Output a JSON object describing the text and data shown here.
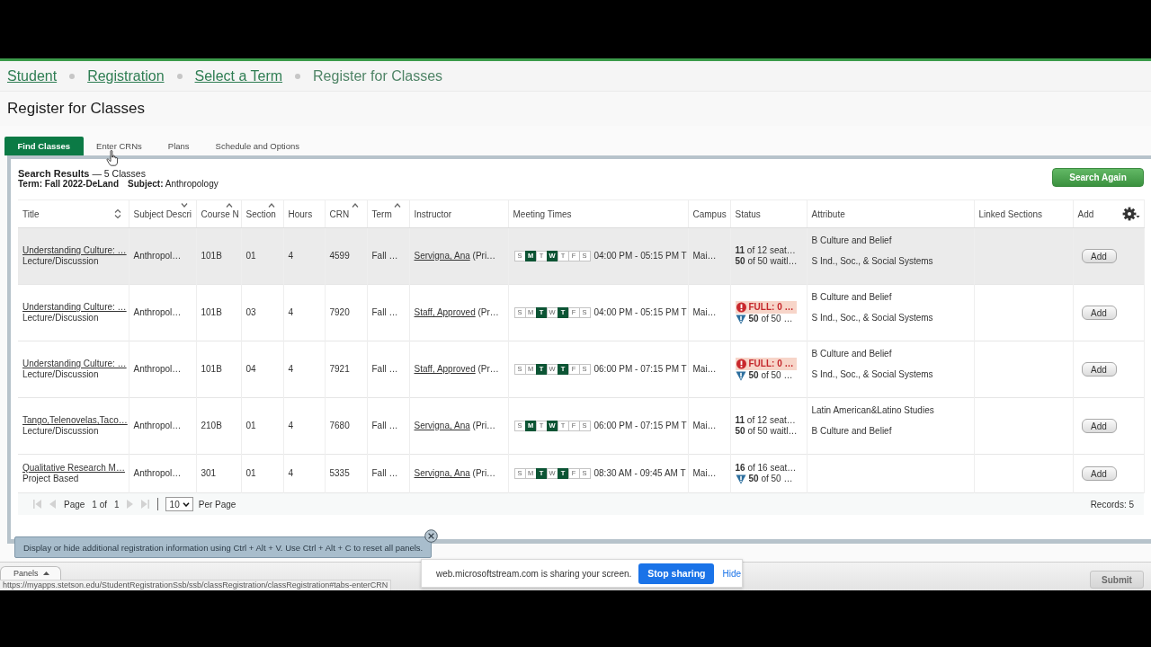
{
  "breadcrumb": [
    {
      "label": "Student",
      "link": true
    },
    {
      "label": "Registration",
      "link": true
    },
    {
      "label": "Select a Term",
      "link": true
    },
    {
      "label": "Register for Classes",
      "link": false
    }
  ],
  "page_title": "Register for Classes",
  "tabs": [
    {
      "label": "Find Classes",
      "selected": true
    },
    {
      "label": "Enter CRNs",
      "selected": false
    },
    {
      "label": "Plans",
      "selected": false
    },
    {
      "label": "Schedule and Options",
      "selected": false
    }
  ],
  "results": {
    "heading": "**Search Results** — 5 Classes",
    "term": "**Term:** Fall 2022-DeLand",
    "subject": "**Subject:** Anthropology",
    "search_again": "Search Again"
  },
  "table": {
    "columns": [
      {
        "label": "Title",
        "kind": "sortable"
      },
      {
        "label": "Subject Descri",
        "kind": "descending"
      },
      {
        "label": "Course N",
        "kind": "ascending"
      },
      {
        "label": "Section",
        "kind": "ascending"
      },
      {
        "label": "Hours",
        "kind": "plain"
      },
      {
        "label": "CRN",
        "kind": "ascending"
      },
      {
        "label": "Term",
        "kind": "ascending"
      },
      {
        "label": "Instructor",
        "kind": "plain"
      },
      {
        "label": "Meeting Times",
        "kind": "plain"
      },
      {
        "label": "Campus",
        "kind": "plain"
      },
      {
        "label": "Status",
        "kind": "plain"
      },
      {
        "label": "Attribute",
        "kind": "plain"
      },
      {
        "label": "Linked Sections",
        "kind": "plain"
      },
      {
        "label": "Add",
        "kind": "plain"
      }
    ],
    "rows": [
      {
        "hovered": true,
        "title": "Understanding Culture: …",
        "schedule_type": "Lecture/Discussion",
        "subject": "Anthropol…",
        "course": "101B",
        "section": "01",
        "hours": "4",
        "crn": "4599",
        "term": "Fall …",
        "instructor": "Servigna, Ana",
        "instructor_role": "(Pri…",
        "days": [
          {
            "label": "S",
            "on": false
          },
          {
            "label": "M",
            "on": true
          },
          {
            "label": "T",
            "on": false
          },
          {
            "label": "W",
            "on": true
          },
          {
            "label": "T",
            "on": false
          },
          {
            "label": "F",
            "on": false
          },
          {
            "label": "S",
            "on": false
          }
        ],
        "time": "04:00 PM - 05:15 PM T",
        "campus": "Mai…",
        "status": [
          {
            "kind": "seats",
            "text": "**11** of 12 seat…"
          },
          {
            "kind": "seats",
            "text": "**50** of 50 waitl…"
          }
        ],
        "attributes": [
          "B Culture and Belief",
          "S Ind., Soc., & Social Systems"
        ],
        "add": "Add"
      },
      {
        "hovered": false,
        "title": "Understanding Culture: …",
        "schedule_type": "Lecture/Discussion",
        "subject": "Anthropol…",
        "course": "101B",
        "section": "03",
        "hours": "4",
        "crn": "7920",
        "term": "Fall …",
        "instructor": "Staff, Approved",
        "instructor_role": "(Pr…",
        "days": [
          {
            "label": "S",
            "on": false
          },
          {
            "label": "M",
            "on": false
          },
          {
            "label": "T",
            "on": true
          },
          {
            "label": "W",
            "on": false
          },
          {
            "label": "T",
            "on": true
          },
          {
            "label": "F",
            "on": false
          },
          {
            "label": "S",
            "on": false
          }
        ],
        "time": "04:00 PM - 05:15 PM T",
        "campus": "Mai…",
        "status": [
          {
            "kind": "full",
            "text": "FULL: 0 …"
          },
          {
            "kind": "waitlist",
            "text": "**50** of 50 …"
          }
        ],
        "attributes": [
          "B Culture and Belief",
          "S Ind., Soc., & Social Systems"
        ],
        "add": "Add"
      },
      {
        "hovered": false,
        "title": "Understanding Culture: …",
        "schedule_type": "Lecture/Discussion",
        "subject": "Anthropol…",
        "course": "101B",
        "section": "04",
        "hours": "4",
        "crn": "7921",
        "term": "Fall …",
        "instructor": "Staff, Approved",
        "instructor_role": "(Pr…",
        "days": [
          {
            "label": "S",
            "on": false
          },
          {
            "label": "M",
            "on": false
          },
          {
            "label": "T",
            "on": true
          },
          {
            "label": "W",
            "on": false
          },
          {
            "label": "T",
            "on": true
          },
          {
            "label": "F",
            "on": false
          },
          {
            "label": "S",
            "on": false
          }
        ],
        "time": "06:00 PM - 07:15 PM T",
        "campus": "Mai…",
        "status": [
          {
            "kind": "full",
            "text": "FULL: 0 …"
          },
          {
            "kind": "waitlist",
            "text": "**50** of 50 …"
          }
        ],
        "attributes": [
          "B Culture and Belief",
          "S Ind., Soc., & Social Systems"
        ],
        "add": "Add"
      },
      {
        "hovered": false,
        "title": "Tango,Telenovelas,Taco…",
        "schedule_type": "Lecture/Discussion",
        "subject": "Anthropol…",
        "course": "210B",
        "section": "01",
        "hours": "4",
        "crn": "7680",
        "term": "Fall …",
        "instructor": "Servigna, Ana",
        "instructor_role": "(Pri…",
        "days": [
          {
            "label": "S",
            "on": false
          },
          {
            "label": "M",
            "on": true
          },
          {
            "label": "T",
            "on": false
          },
          {
            "label": "W",
            "on": true
          },
          {
            "label": "T",
            "on": false
          },
          {
            "label": "F",
            "on": false
          },
          {
            "label": "S",
            "on": false
          }
        ],
        "time": "06:00 PM - 07:15 PM T",
        "campus": "Mai…",
        "status": [
          {
            "kind": "seats",
            "text": "**11** of 12 seat…"
          },
          {
            "kind": "seats",
            "text": "**50** of 50 waitl…"
          }
        ],
        "attributes": [
          "Latin American&Latino Studies",
          "B Culture and Belief"
        ],
        "add": "Add"
      },
      {
        "hovered": false,
        "title": "Qualitative Research M…",
        "schedule_type": "Project Based",
        "subject": "Anthropol…",
        "course": "301",
        "section": "01",
        "hours": "4",
        "crn": "5335",
        "term": "Fall …",
        "instructor": "Servigna, Ana",
        "instructor_role": "(Pri…",
        "days": [
          {
            "label": "S",
            "on": false
          },
          {
            "label": "M",
            "on": false
          },
          {
            "label": "T",
            "on": true
          },
          {
            "label": "W",
            "on": false
          },
          {
            "label": "T",
            "on": true
          },
          {
            "label": "F",
            "on": false
          },
          {
            "label": "S",
            "on": false
          }
        ],
        "time": "08:30 AM - 09:45 AM T",
        "campus": "Mai…",
        "status": [
          {
            "kind": "seats",
            "text": "**16** of 16 seat…"
          },
          {
            "kind": "waitlist",
            "text": "**50** of 50 …"
          }
        ],
        "add": "Add"
      }
    ]
  },
  "pagination": {
    "nav_before": [
      {
        "kind": "first",
        "disabled": true
      },
      {
        "kind": "prev",
        "disabled": true
      }
    ],
    "page_label": "Page",
    "current": "1 of",
    "total": "1",
    "nav_after": [
      {
        "kind": "next",
        "disabled": true
      },
      {
        "kind": "last",
        "disabled": true
      }
    ],
    "page_size": "10",
    "per_page": "Per Page",
    "records": "Records: 5"
  },
  "tooltip": {
    "text": "Display or hide additional registration information using Ctrl + Alt + V. Use Ctrl + Alt + C to reset all panels."
  },
  "bottom_bar": {
    "panels": "Panels",
    "submit": {
      "label": "Submit",
      "disabled": true
    }
  },
  "status_url": "https://myapps.stetson.edu/StudentRegistrationSsb/ssb/classRegistration/classRegistration#tabs-enterCRN",
  "share_bar": {
    "message": "web.microsoftstream.com is sharing your screen.",
    "stop": "Stop sharing",
    "hide": "Hide"
  }
}
